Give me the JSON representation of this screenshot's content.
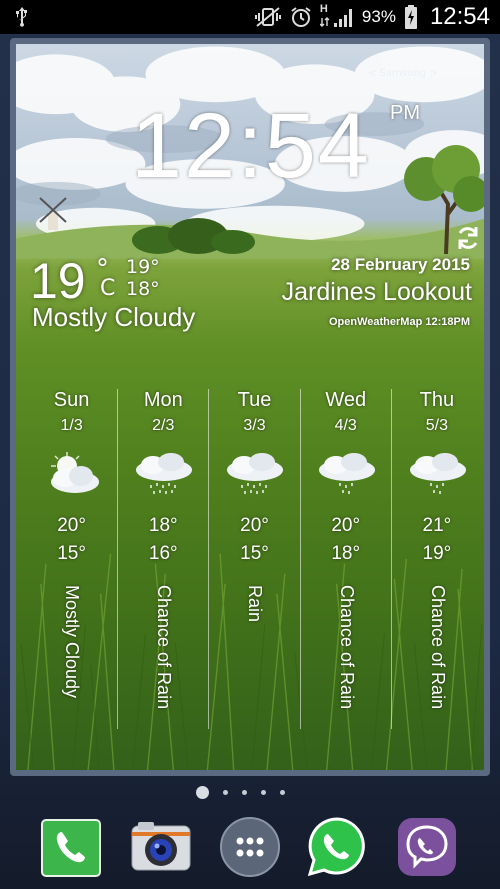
{
  "status_bar": {
    "battery_percent": "93%",
    "time": "12:54",
    "network": "H",
    "icons": [
      "usb-icon",
      "mute-vibrate-icon",
      "alarm-icon",
      "signal-icon",
      "battery-charging-icon"
    ]
  },
  "widget": {
    "clock": "12:54",
    "ampm": "PM",
    "sponsor": "< Samsung >",
    "current": {
      "temp": "19",
      "deg": "°",
      "unit": "C",
      "high": "19°",
      "low": "18°",
      "condition": "Mostly Cloudy"
    },
    "date": "28 February 2015",
    "location": "Jardines Lookout",
    "source": "OpenWeatherMap 12:18PM",
    "forecast": [
      {
        "day": "Sun",
        "date": "1/3",
        "high": "20°",
        "low": "15°",
        "condition": "Mostly Cloudy",
        "icon": "sun-cloud-icon"
      },
      {
        "day": "Mon",
        "date": "2/3",
        "high": "18°",
        "low": "16°",
        "condition": "Chance of Rain",
        "icon": "rain-cloud-icon"
      },
      {
        "day": "Tue",
        "date": "3/3",
        "high": "20°",
        "low": "15°",
        "condition": "Rain",
        "icon": "rain-cloud-icon"
      },
      {
        "day": "Wed",
        "date": "4/3",
        "high": "20°",
        "low": "18°",
        "condition": "Chance of Rain",
        "icon": "rain-cloud-icon"
      },
      {
        "day": "Thu",
        "date": "5/3",
        "high": "21°",
        "low": "19°",
        "condition": "Chance of Rain",
        "icon": "rain-cloud-icon"
      }
    ]
  },
  "dock": {
    "apps": [
      "phone-icon",
      "camera-icon",
      "apps-drawer-icon",
      "whatsapp-icon",
      "viber-icon"
    ]
  },
  "colors": {
    "phone_green": "#3cb54a",
    "whatsapp_green": "#2ec24a",
    "viber_purple": "#7b519d",
    "grass": "#4f7f1d"
  }
}
